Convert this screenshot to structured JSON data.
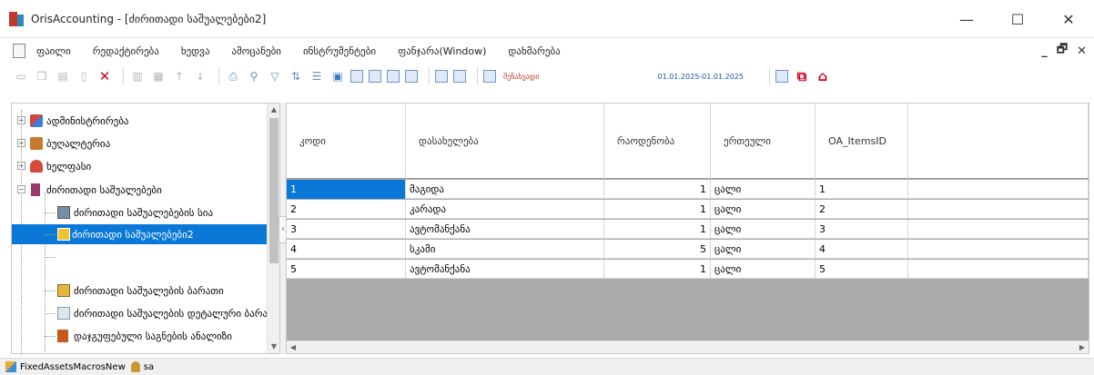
{
  "window": {
    "title": "OrisAccounting - [ძირითადი საშუალებები2]",
    "minimize": "—",
    "maximize": "☐",
    "close": "✕"
  },
  "menu": {
    "items": [
      "ფაილი",
      "რედაქტირება",
      "ხედვა",
      "ამოცანები",
      "ინსტრუმენტები",
      "ფანჯარა(Window)",
      "დახმარება"
    ],
    "right_minimize": "_",
    "right_restore": "🗗",
    "right_close": "✕"
  },
  "toolbar": {
    "saved_label": "შენახვადი",
    "date_range": "01.01.2025-01.01.2025",
    "icons": [
      "new-icon",
      "copy-icon",
      "paste-icon",
      "cut-icon",
      "delete-icon",
      "print-icon",
      "find-icon",
      "filter-icon",
      "sort-icon",
      "columns-icon",
      "export-icon"
    ]
  },
  "tree": {
    "items": [
      {
        "label": "ადმინისტრირება",
        "icon": "admin-icon",
        "expander": "+"
      },
      {
        "label": "ბუღალტერია",
        "icon": "accounting-icon",
        "expander": "+"
      },
      {
        "label": "ხელფასი",
        "icon": "payroll-icon",
        "expander": "+"
      },
      {
        "label": "ძირითადი საშუალებები",
        "icon": "fixed-assets-icon",
        "expander": "−"
      },
      {
        "label": "ძირითადი საშუალებების სია",
        "icon": "list-icon"
      },
      {
        "label": "ძირითადი საშუალებები2",
        "icon": "item-icon",
        "selected": true
      },
      {
        "label": ""
      },
      {
        "label": "ძირითადი საშუალების ბარათი",
        "icon": "card-icon"
      },
      {
        "label": "ძირითადი საშუალების დეტალური ბარათი",
        "icon": "detail-card-icon"
      },
      {
        "label": "დაჯგუფებული საგნების ანალიზი",
        "icon": "analysis-icon"
      }
    ]
  },
  "grid": {
    "columns": [
      "კოდი",
      "დასახელება",
      "რაოდენობა",
      "ერთეული",
      "OA_ItemsID",
      ""
    ],
    "rows": [
      [
        "1",
        "მაგიდა",
        "1",
        "ცალი",
        "1"
      ],
      [
        "2",
        "კარადა",
        "1",
        "ცალი",
        "2"
      ],
      [
        "3",
        "ავტომანქანა",
        "1",
        "ცალი",
        "3"
      ],
      [
        "4",
        "სკამი",
        "5",
        "ცალი",
        "4"
      ],
      [
        "5",
        "ავტომანქანა",
        "1",
        "ცალი",
        "5"
      ]
    ]
  },
  "status": {
    "left": "FixedAssetsMacrosNew",
    "user": "sa"
  }
}
